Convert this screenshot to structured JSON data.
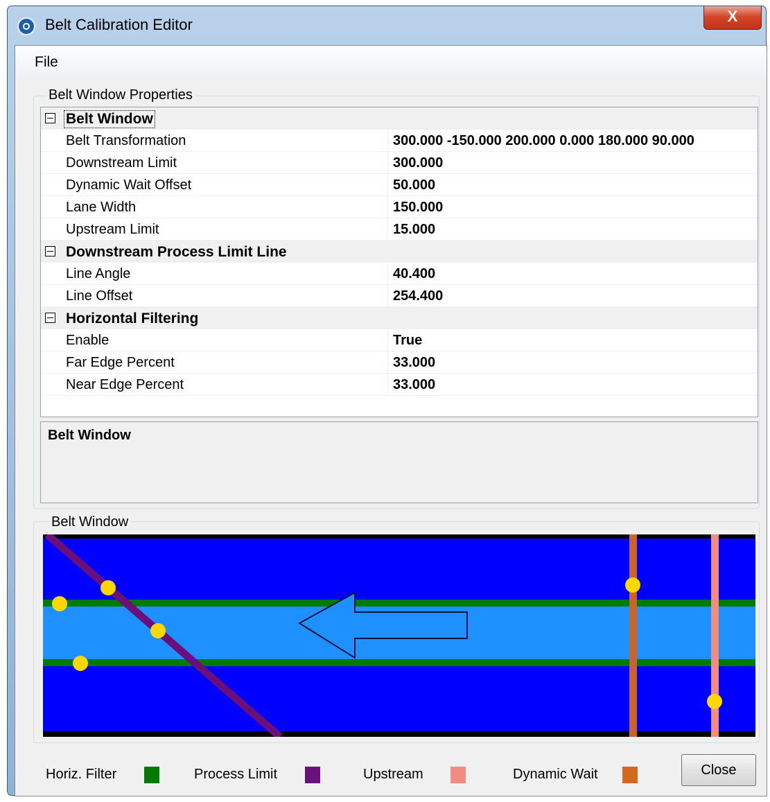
{
  "window": {
    "title": "Belt Calibration Editor",
    "close_glyph": "X"
  },
  "menu": {
    "file": "File"
  },
  "properties_group": {
    "label": "Belt Window Properties"
  },
  "grid": {
    "categories": [
      {
        "name": "Belt Window",
        "rows": [
          {
            "name": "Belt Transformation",
            "value": "300.000 -150.000 200.000 0.000 180.000 90.000"
          },
          {
            "name": "Downstream Limit",
            "value": "300.000"
          },
          {
            "name": "Dynamic Wait Offset",
            "value": "50.000"
          },
          {
            "name": "Lane Width",
            "value": "150.000"
          },
          {
            "name": "Upstream Limit",
            "value": "15.000"
          }
        ]
      },
      {
        "name": "Downstream Process Limit Line",
        "rows": [
          {
            "name": "Line Angle",
            "value": "40.400"
          },
          {
            "name": "Line Offset",
            "value": "254.400"
          }
        ]
      },
      {
        "name": "Horizontal Filtering",
        "rows": [
          {
            "name": "Enable",
            "value": "True"
          },
          {
            "name": "Far Edge Percent",
            "value": "33.000"
          },
          {
            "name": "Near Edge Percent",
            "value": "33.000"
          }
        ]
      }
    ]
  },
  "description": {
    "title": "Belt Window"
  },
  "belt_group": {
    "label": "Belt Window"
  },
  "legend": [
    {
      "label": "Horiz. Filter",
      "color": "#007a00"
    },
    {
      "label": "Process Limit",
      "color": "#6b0f7a"
    },
    {
      "label": "Upstream",
      "color": "#f28c80"
    },
    {
      "label": "Dynamic Wait",
      "color": "#d2691e"
    }
  ],
  "colors": {
    "belt": "#0000ff",
    "lane": "#1e90ff",
    "filter_line": "#007a00",
    "process_limit": "#6b0f7a",
    "upstream": "#f28c80",
    "dynamic_wait": "#c8642a",
    "handle": "#ffd700"
  },
  "buttons": {
    "close": "Close"
  }
}
